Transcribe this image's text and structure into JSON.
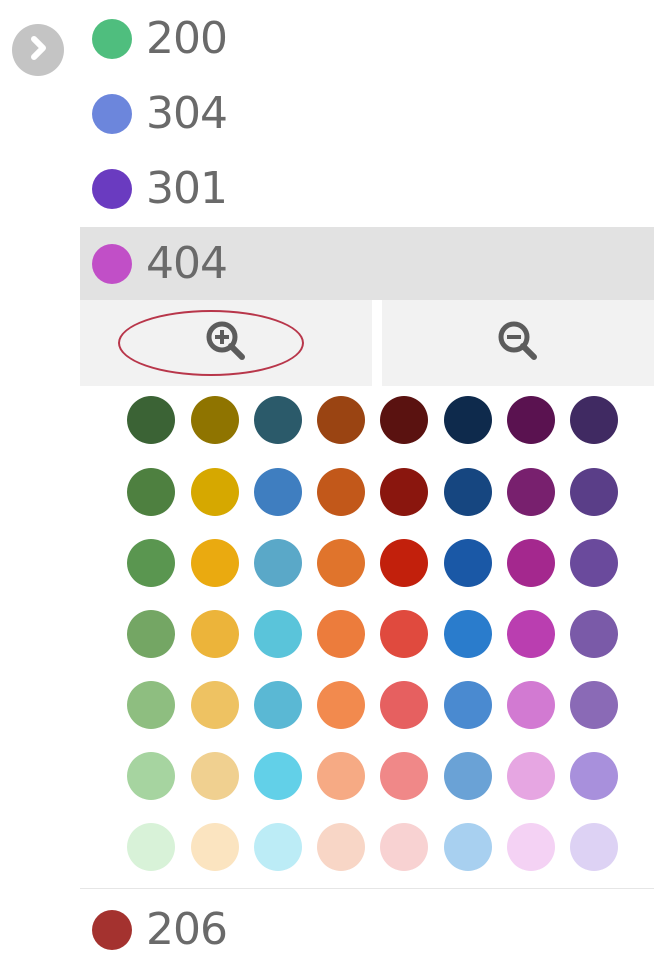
{
  "legend": {
    "items": [
      {
        "label": "200",
        "color": "#4fbe7e",
        "selected": false
      },
      {
        "label": "304",
        "color": "#6c86dc",
        "selected": false
      },
      {
        "label": "301",
        "color": "#6a3bc0",
        "selected": false
      },
      {
        "label": "404",
        "color": "#c14fc7",
        "selected": true
      }
    ],
    "bottom_item": {
      "label": "206",
      "color": "#a4322f"
    }
  },
  "zoom": {
    "in_icon": "zoom-in-icon",
    "out_icon": "zoom-out-icon"
  },
  "annotation_color": "#b8364a",
  "palette": {
    "rows": [
      [
        "#3b6335",
        "#8f7400",
        "#2b5a6a",
        "#9a4412",
        "#5a1210",
        "#0e2a4c",
        "#5a1250",
        "#402a62"
      ],
      [
        "#4e8040",
        "#d6a800",
        "#3f7ec0",
        "#c2581a",
        "#8a160e",
        "#164680",
        "#78206e",
        "#5a3e88"
      ],
      [
        "#5a9650",
        "#eaaa10",
        "#5aa8c8",
        "#e0742c",
        "#c2200c",
        "#1a58a6",
        "#a4288e",
        "#6a4a9c"
      ],
      [
        "#74a664",
        "#ecb43a",
        "#5ac4da",
        "#ec7c3c",
        "#e04a3e",
        "#2a7ccc",
        "#ba3eb0",
        "#7a5aa8"
      ],
      [
        "#8ebe80",
        "#eec262",
        "#5ab8d4",
        "#f28a4e",
        "#e66060",
        "#4a8ad0",
        "#d27ad2",
        "#8a6ab6"
      ],
      [
        "#a6d4a0",
        "#f0d090",
        "#62d0e8",
        "#f6aa84",
        "#f08888",
        "#6aa2d6",
        "#e6a6e2",
        "#a890dc"
      ],
      [
        "#d8f2d8",
        "#fbe4c0",
        "#bcecf6",
        "#f8d6c6",
        "#f8d2d2",
        "#a8d0f0",
        "#f4d2f4",
        "#ddd2f4"
      ]
    ]
  }
}
